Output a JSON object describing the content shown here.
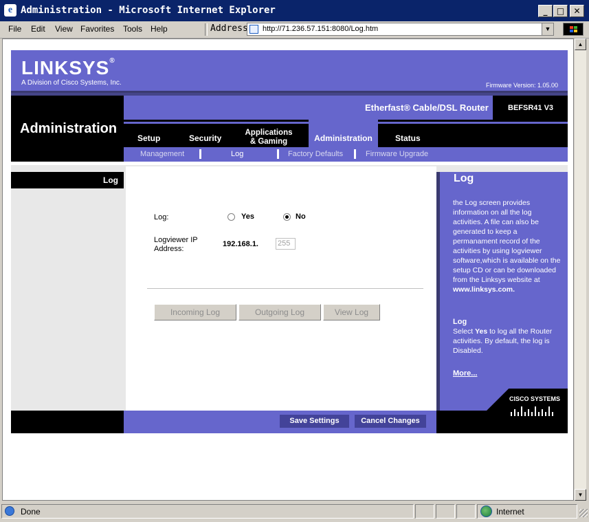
{
  "window": {
    "title": "Administration - Microsoft Internet Explorer",
    "min": "_",
    "max": "□",
    "close": "✕"
  },
  "menu": {
    "file": "File",
    "edit": "Edit",
    "view": "View",
    "favorites": "Favorites",
    "tools": "Tools",
    "help": "Help"
  },
  "address": {
    "label": "Address",
    "url": "http://71.236.57.151:8080/Log.htm"
  },
  "status": {
    "text": "Done",
    "zone": "Internet"
  },
  "router": {
    "brand": "LINKSYS",
    "brand_mark": "®",
    "division": "A Division of Cisco Systems, Inc.",
    "firmware": "Firmware Version: 1.05.00",
    "product": "Etherfast® Cable/DSL Router",
    "model": "BEFSR41 V3",
    "section_title": "Administration",
    "tabs": [
      {
        "label": "Setup"
      },
      {
        "label": "Security"
      },
      {
        "label": "Applications & Gaming"
      },
      {
        "label": "Administration"
      },
      {
        "label": "Status"
      }
    ],
    "subtabs": [
      {
        "label": "Management"
      },
      {
        "label": "Log"
      },
      {
        "label": "Factory Defaults"
      },
      {
        "label": "Firmware Upgrade"
      }
    ],
    "side_label": "Log",
    "form": {
      "log_label": "Log:",
      "yes": "Yes",
      "no": "No",
      "ip_label": "Logviewer IP Address:",
      "ip_prefix": "192.168.1.",
      "ip_last": "255"
    },
    "buttons": {
      "incoming": "Incoming Log",
      "outgoing": "Outgoing Log",
      "view": "View Log",
      "save": "Save Settings",
      "cancel": "Cancel Changes"
    },
    "help": {
      "title": "Log",
      "body": "the Log screen provides information on all the log activities. A file can also be generated to keep a permanament record of the activities by using logviewer software,which is available on the setup CD or can be downloaded from the Linksys website at",
      "site": "www.linksys.com.",
      "sub_title": "Log",
      "select": "Select",
      "yes": "Yes",
      "sub_body": "to log all the Router activities. By default, the log is Disabled.",
      "more": "More...",
      "cisco": "CISCO SYSTEMS"
    }
  }
}
